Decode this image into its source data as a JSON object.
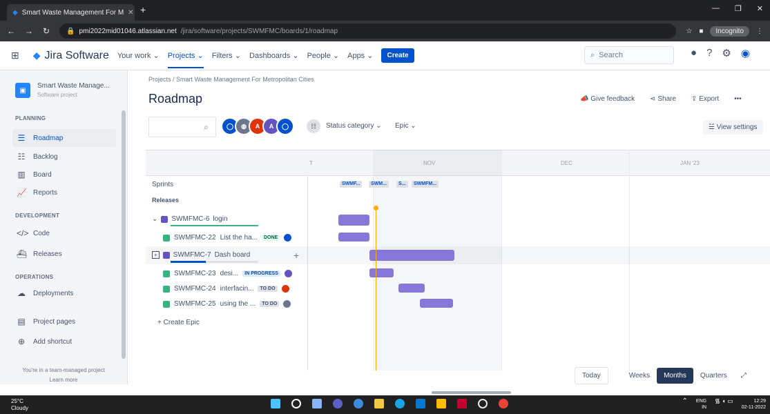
{
  "browser": {
    "tab_title": "Smart Waste Management For M",
    "url_host": "pmi2022mid01046.atlassian.net",
    "url_path": "/jira/software/projects/SWMFMC/boards/1/roadmap",
    "incognito": "Incognito"
  },
  "header": {
    "logo": "Jira Software",
    "nav": [
      "Your work",
      "Projects",
      "Filters",
      "Dashboards",
      "People",
      "Apps"
    ],
    "create": "Create",
    "search_placeholder": "Search"
  },
  "sidebar": {
    "project_name": "Smart Waste Manage...",
    "project_type": "Software project",
    "planning": "PLANNING",
    "items_planning": [
      "Roadmap",
      "Backlog",
      "Board",
      "Reports"
    ],
    "development": "DEVELOPMENT",
    "items_dev": [
      "Code",
      "Releases"
    ],
    "operations": "OPERATIONS",
    "items_ops": [
      "Deployments"
    ],
    "project_pages": "Project pages",
    "add_shortcut": "Add shortcut",
    "note": "You're in a team-managed project",
    "learn_more": "Learn more"
  },
  "main": {
    "breadcrumb": "Projects / Smart Waste Management For Metropolitan Cities",
    "title": "Roadmap",
    "give_feedback": "Give feedback",
    "share": "Share",
    "export": "Export",
    "more": "•••",
    "status_category": "Status category",
    "epic": "Epic",
    "view_settings": "View settings"
  },
  "timeline": {
    "months": [
      "T",
      "NOV",
      "DEC",
      "JAN '23"
    ],
    "sprints_label": "Sprints",
    "releases_label": "Releases",
    "sprints": [
      "SWMF...",
      "SWM...",
      "S...",
      "SWMFM..."
    ],
    "create_epic": "+ Create Epic"
  },
  "epics": [
    {
      "key": "SWMFMC-6",
      "name": "login",
      "issues": [
        {
          "key": "SWMFMC-22",
          "name": "List the ha...",
          "status": "DONE"
        }
      ]
    },
    {
      "key": "SWMFMC-7",
      "name": "Dash board",
      "issues": [
        {
          "key": "SWMFMC-23",
          "name": "desi...",
          "status": "IN PROGRESS"
        },
        {
          "key": "SWMFMC-24",
          "name": "interfacin...",
          "status": "TO DO"
        },
        {
          "key": "SWMFMC-25",
          "name": "using the ...",
          "status": "TO DO"
        }
      ]
    }
  ],
  "zoom": {
    "today": "Today",
    "options": [
      "Weeks",
      "Months",
      "Quarters"
    ],
    "selected": "Months"
  },
  "taskbar": {
    "temp": "25°C",
    "weather": "Cloudy",
    "lang": "ENG",
    "region": "IN",
    "time": "12:29",
    "date": "02-11-2022"
  },
  "colors": {
    "accent": "#0052cc",
    "epic": "#8777d9",
    "today": "#ffab00"
  }
}
